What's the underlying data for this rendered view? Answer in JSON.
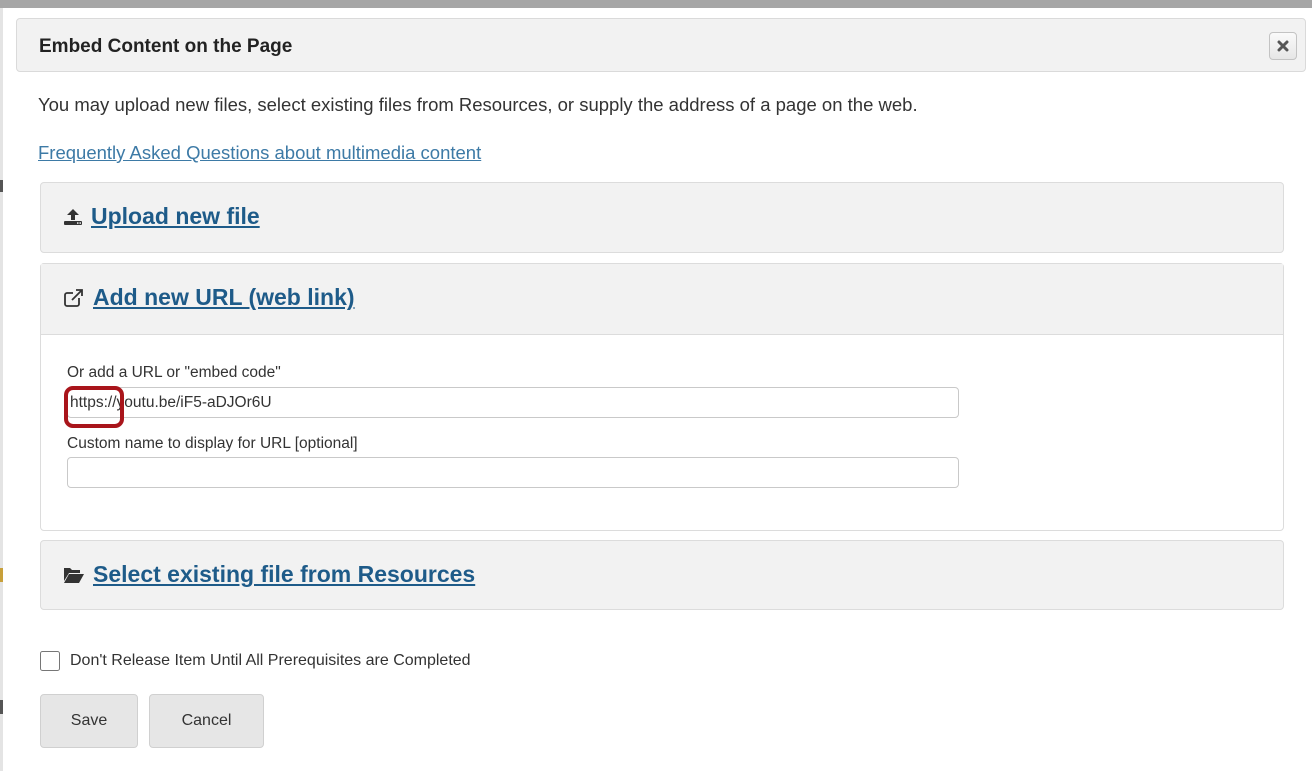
{
  "dialog": {
    "title": "Embed Content on the Page",
    "close_icon": "close-icon"
  },
  "intro_text": "You may upload new files, select existing files from Resources, or supply the address of a page on the web.",
  "faq_link": "Frequently Asked Questions about multimedia content",
  "sections": {
    "upload": {
      "label": "Upload new file",
      "icon": "upload-icon"
    },
    "add_url": {
      "label": "Add new URL (web link)",
      "icon": "external-link-icon",
      "url_field_label": "Or add a URL or \"embed code\"",
      "url_value": "https://youtu.be/iF5-aDJOr6U",
      "name_field_label": "Custom name to display for URL [optional]",
      "name_value": ""
    },
    "resources": {
      "label": "Select existing file from Resources",
      "icon": "folder-open-icon"
    }
  },
  "prerequisite_checkbox": {
    "label": "Don't Release Item Until All Prerequisites are Completed",
    "checked": false
  },
  "buttons": {
    "save": "Save",
    "cancel": "Cancel"
  },
  "colors": {
    "link": "#1e5b89",
    "highlight": "#a9151b",
    "panel_bg": "#f2f2f2"
  }
}
